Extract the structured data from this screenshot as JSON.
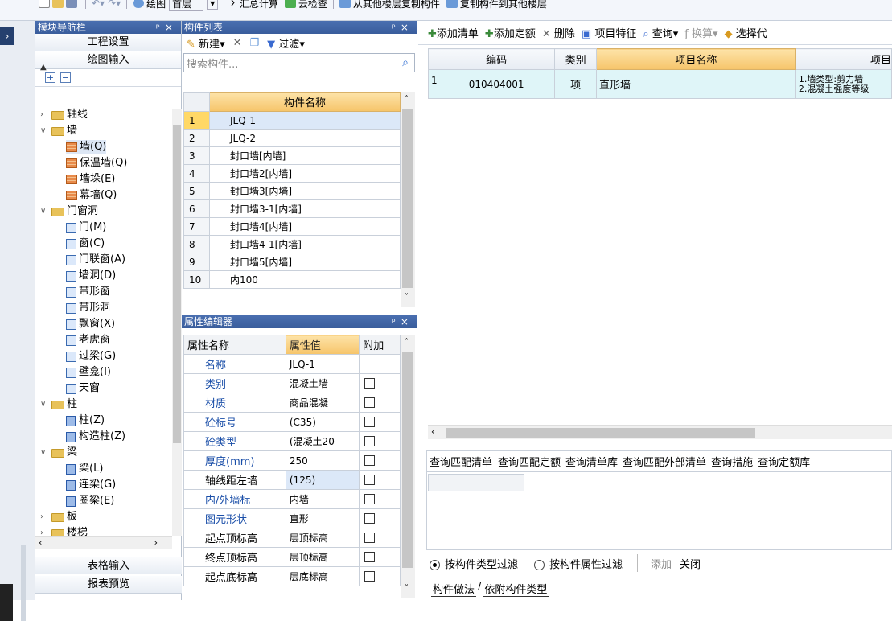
{
  "toolbar": {
    "draw_label": "绘图",
    "floor_value": "首层",
    "sum_label": "汇总计算",
    "cloud_label": "云检查",
    "copy_from_label": "从其他楼层复制构件",
    "copy_to_label": "复制构件到其他楼层"
  },
  "nav": {
    "title": "模块导航栏",
    "project_settings": "工程设置",
    "drawing_input": "绘图输入",
    "table_input": "表格输入",
    "report_preview": "报表预览",
    "tree": [
      {
        "label": "轴线",
        "level": 0,
        "expanded": false,
        "icon": "folder-icon"
      },
      {
        "label": "墙",
        "level": 0,
        "expanded": true,
        "icon": "folder-icon"
      },
      {
        "label": "墙(Q)",
        "level": 1,
        "icon": "wall-icon",
        "selected": true
      },
      {
        "label": "保温墙(Q)",
        "level": 1,
        "icon": "insulated-wall-icon"
      },
      {
        "label": "墙垛(E)",
        "level": 1,
        "icon": "wall-pier-icon"
      },
      {
        "label": "幕墙(Q)",
        "level": 1,
        "icon": "curtain-wall-icon"
      },
      {
        "label": "门窗洞",
        "level": 0,
        "expanded": true,
        "icon": "folder-icon"
      },
      {
        "label": "门(M)",
        "level": 1,
        "icon": "door-icon"
      },
      {
        "label": "窗(C)",
        "level": 1,
        "icon": "window-icon"
      },
      {
        "label": "门联窗(A)",
        "level": 1,
        "icon": "door-window-icon"
      },
      {
        "label": "墙洞(D)",
        "level": 1,
        "icon": "wall-opening-icon"
      },
      {
        "label": "带形窗",
        "level": 1,
        "icon": "strip-window-icon"
      },
      {
        "label": "带形洞",
        "level": 1,
        "icon": "strip-opening-icon"
      },
      {
        "label": "飘窗(X)",
        "level": 1,
        "icon": "bay-window-icon"
      },
      {
        "label": "老虎窗",
        "level": 1,
        "icon": "dormer-icon"
      },
      {
        "label": "过梁(G)",
        "level": 1,
        "icon": "lintel-icon"
      },
      {
        "label": "壁龛(I)",
        "level": 1,
        "icon": "niche-icon"
      },
      {
        "label": "天窗",
        "level": 1,
        "icon": "skylight-icon"
      },
      {
        "label": "柱",
        "level": 0,
        "expanded": true,
        "icon": "folder-icon"
      },
      {
        "label": "柱(Z)",
        "level": 1,
        "icon": "column-icon"
      },
      {
        "label": "构造柱(Z)",
        "level": 1,
        "icon": "structural-column-icon"
      },
      {
        "label": "梁",
        "level": 0,
        "expanded": true,
        "icon": "folder-icon"
      },
      {
        "label": "梁(L)",
        "level": 1,
        "icon": "beam-icon"
      },
      {
        "label": "连梁(G)",
        "level": 1,
        "icon": "coupling-beam-icon"
      },
      {
        "label": "圈梁(E)",
        "level": 1,
        "icon": "ring-beam-icon"
      },
      {
        "label": "板",
        "level": 0,
        "expanded": false,
        "icon": "folder-icon"
      },
      {
        "label": "楼梯",
        "level": 0,
        "expanded": false,
        "icon": "folder-icon"
      }
    ]
  },
  "component_list": {
    "title": "构件列表",
    "new_label": "新建",
    "filter_label": "过滤",
    "search_placeholder": "搜索构件...",
    "header": "构件名称",
    "rows": [
      {
        "n": "1",
        "name": "JLQ-1"
      },
      {
        "n": "2",
        "name": "JLQ-2"
      },
      {
        "n": "3",
        "name": "封口墙[内墙]"
      },
      {
        "n": "4",
        "name": "封口墙2[内墙]"
      },
      {
        "n": "5",
        "name": "封口墙3[内墙]"
      },
      {
        "n": "6",
        "name": "封口墙3-1[内墙]"
      },
      {
        "n": "7",
        "name": "封口墙4[内墙]"
      },
      {
        "n": "8",
        "name": "封口墙4-1[内墙]"
      },
      {
        "n": "9",
        "name": "封口墙5[内墙]"
      },
      {
        "n": "10",
        "name": "内100"
      }
    ]
  },
  "props": {
    "title": "属性编辑器",
    "col_name": "属性名称",
    "col_value": "属性值",
    "col_extra": "附加",
    "rows": [
      {
        "k": "名称",
        "v": "JLQ-1",
        "blue": true,
        "cb": false
      },
      {
        "k": "类别",
        "v": "混凝土墙",
        "blue": true,
        "cb": true
      },
      {
        "k": "材质",
        "v": "商品混凝",
        "blue": true,
        "cb": true
      },
      {
        "k": "砼标号",
        "v": "(C35)",
        "blue": true,
        "cb": true
      },
      {
        "k": "砼类型",
        "v": "(混凝土20",
        "blue": true,
        "cb": true
      },
      {
        "k": "厚度(mm)",
        "v": "250",
        "blue": true,
        "cb": true
      },
      {
        "k": "轴线距左墙",
        "v": "(125)",
        "blue": false,
        "cb": true,
        "hl": true
      },
      {
        "k": "内/外墙标",
        "v": "内墙",
        "blue": true,
        "cb": true
      },
      {
        "k": "图元形状",
        "v": "直形",
        "blue": true,
        "cb": true
      },
      {
        "k": "起点顶标高",
        "v": "层顶标高",
        "blue": false,
        "cb": true
      },
      {
        "k": "终点顶标高",
        "v": "层顶标高",
        "blue": false,
        "cb": true
      },
      {
        "k": "起点底标高",
        "v": "层底标高",
        "blue": false,
        "cb": true
      }
    ]
  },
  "right": {
    "add_list": "添加清单",
    "add_quota": "添加定额",
    "delete": "删除",
    "item_feature": "项目特征",
    "query": "查询",
    "convert": "换算",
    "select_code": "选择代",
    "headers": {
      "code": "编码",
      "type": "类别",
      "name": "项目名称",
      "feature": "项目"
    },
    "row": {
      "n": "1",
      "code": "010404001",
      "type": "项",
      "name": "直形墙",
      "feature1": "1.墙类型:剪力墙",
      "feature2": "2.混凝土强度等级"
    },
    "query_tabs": [
      "查询匹配清单",
      "查询匹配定额",
      "查询清单库",
      "查询匹配外部清单",
      "查询措施",
      "查询定额库"
    ],
    "filter_by_type": "按构件类型过滤",
    "filter_by_attr": "按构件属性过滤",
    "add": "添加",
    "close": "关闭",
    "bottom_tabs": [
      "构件做法",
      "依附构件类型"
    ]
  }
}
